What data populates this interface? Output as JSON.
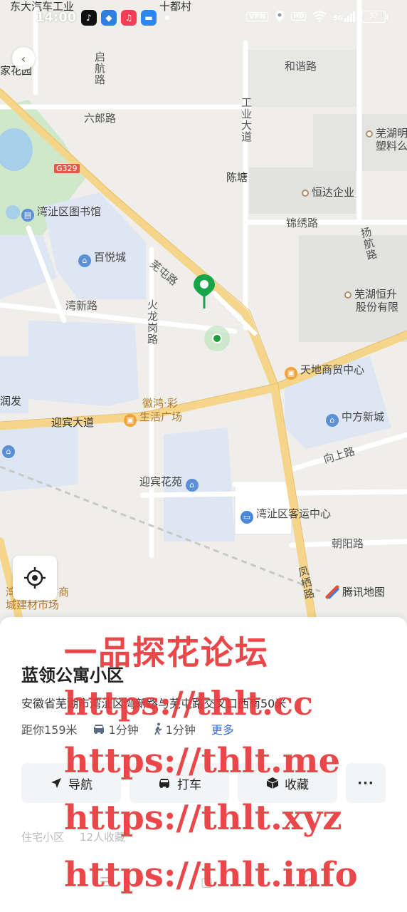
{
  "status_bar": {
    "time": "14:00",
    "vpn": "VPN",
    "hd": "HD",
    "network": "5G",
    "battery": "37",
    "apps": [
      {
        "name": "tiktok-icon",
        "color": "#111111",
        "glyph": "♪"
      },
      {
        "name": "browser-icon",
        "color": "#2f7fe0",
        "glyph": "◆"
      },
      {
        "name": "music-icon",
        "color": "#f23d55",
        "glyph": "♫"
      },
      {
        "name": "mail-icon",
        "color": "#2a86f0",
        "glyph": "▬"
      }
    ]
  },
  "map": {
    "labels": {
      "top_partial": "东大汽车工业",
      "top_center": "十都村",
      "hexie_road": "和谐路",
      "qihang_road": "启航路",
      "huayuan_partial": "家花园",
      "liulang_road": "六郎路",
      "gongye_ave": "工业大道",
      "wuhu_plastic_1": "芜湖明",
      "wuhu_plastic_2": "塑料么",
      "g329": "G329",
      "chentang": "陈塘",
      "hengda": "恒达企业",
      "library": "湾沚区图书馆",
      "jinxiu_road": "锦绣路",
      "yanghang_road": "扬航路",
      "baiyue_city": "百悦城",
      "wutun_road": "芜屯路",
      "wuhu_hengsheng_1": "芜湖恒升",
      "wuhu_hengsheng_2": "股份有限",
      "wanxin_road": "湾新路",
      "huolonggang_road": "火龙岗路",
      "tiandi_center": "天地商贸中心",
      "runfa_partial": "润发",
      "huihong_1": "徽鸿·彩",
      "huihong_2": "生活广场",
      "zhongfang": "中方新城",
      "yingbin_ave": "迎宾大道",
      "xiangshang_road": "向上路",
      "yingbin_garden": "迎宾花苑",
      "bus_center": "湾沚区客运中心",
      "chaoyang_road": "朝阳路",
      "market_1": "湾沚",
      "market_2": "城建材市场",
      "market_suffix": "商",
      "fengqi_road": "凤栖路",
      "tencent_map": "腾讯地图"
    }
  },
  "place": {
    "name": "蓝领公寓小区",
    "address": "安徽省芜湖市湾沚区湾新路与芜屯路交叉口西南50米",
    "distance": "距你159米",
    "drive_time": "1分钟",
    "walk_time": "1分钟",
    "more": "更多"
  },
  "actions": {
    "navigate": "导航",
    "taxi": "打车",
    "favorite": "收藏",
    "more": "···"
  },
  "meta": {
    "category": "住宅小区",
    "favorites": "12人收藏"
  },
  "overlay_text": [
    "一品探花论坛",
    "https://thlt.cc",
    "https://thlt.me",
    "https://thlt.xyz",
    "https://thlt.info"
  ]
}
